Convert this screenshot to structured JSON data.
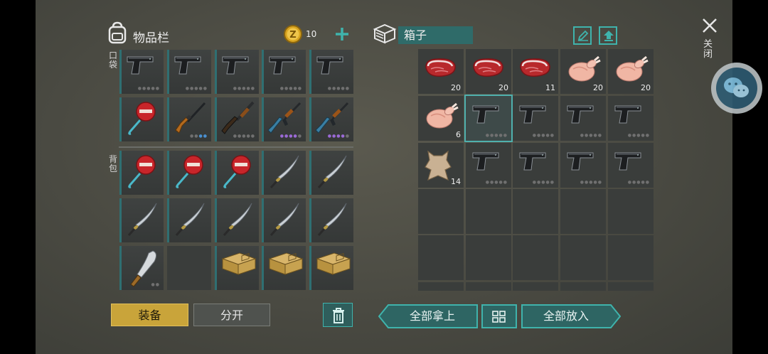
{
  "inventory": {
    "title": "物品栏",
    "coins": "10",
    "pocket_label": "口袋",
    "backpack_label": "背包",
    "equip_button": "装备",
    "split_button": "分开"
  },
  "box": {
    "title": "箱子",
    "take_all_button": "全部拿上",
    "put_all_button": "全部放入",
    "slots": [
      {
        "item": "raw-steak",
        "count": "20"
      },
      {
        "item": "raw-steak",
        "count": "20"
      },
      {
        "item": "raw-steak",
        "count": "11"
      },
      {
        "item": "raw-chicken",
        "count": "20"
      },
      {
        "item": "raw-chicken",
        "count": "20"
      },
      {
        "item": "raw-chicken",
        "count": "6"
      },
      {
        "item": "pistol",
        "count": ""
      },
      {
        "item": "pistol",
        "count": ""
      },
      {
        "item": "pistol",
        "count": ""
      },
      {
        "item": "pistol",
        "count": ""
      },
      {
        "item": "animal-hide",
        "count": "14"
      },
      {
        "item": "pistol",
        "count": ""
      },
      {
        "item": "pistol",
        "count": ""
      },
      {
        "item": "pistol",
        "count": ""
      },
      {
        "item": "pistol",
        "count": ""
      }
    ]
  },
  "close_label": "关闭",
  "colors": {
    "accent": "#2f8f8a",
    "equip": "#c9a43a",
    "coin": "#e3b32a"
  }
}
